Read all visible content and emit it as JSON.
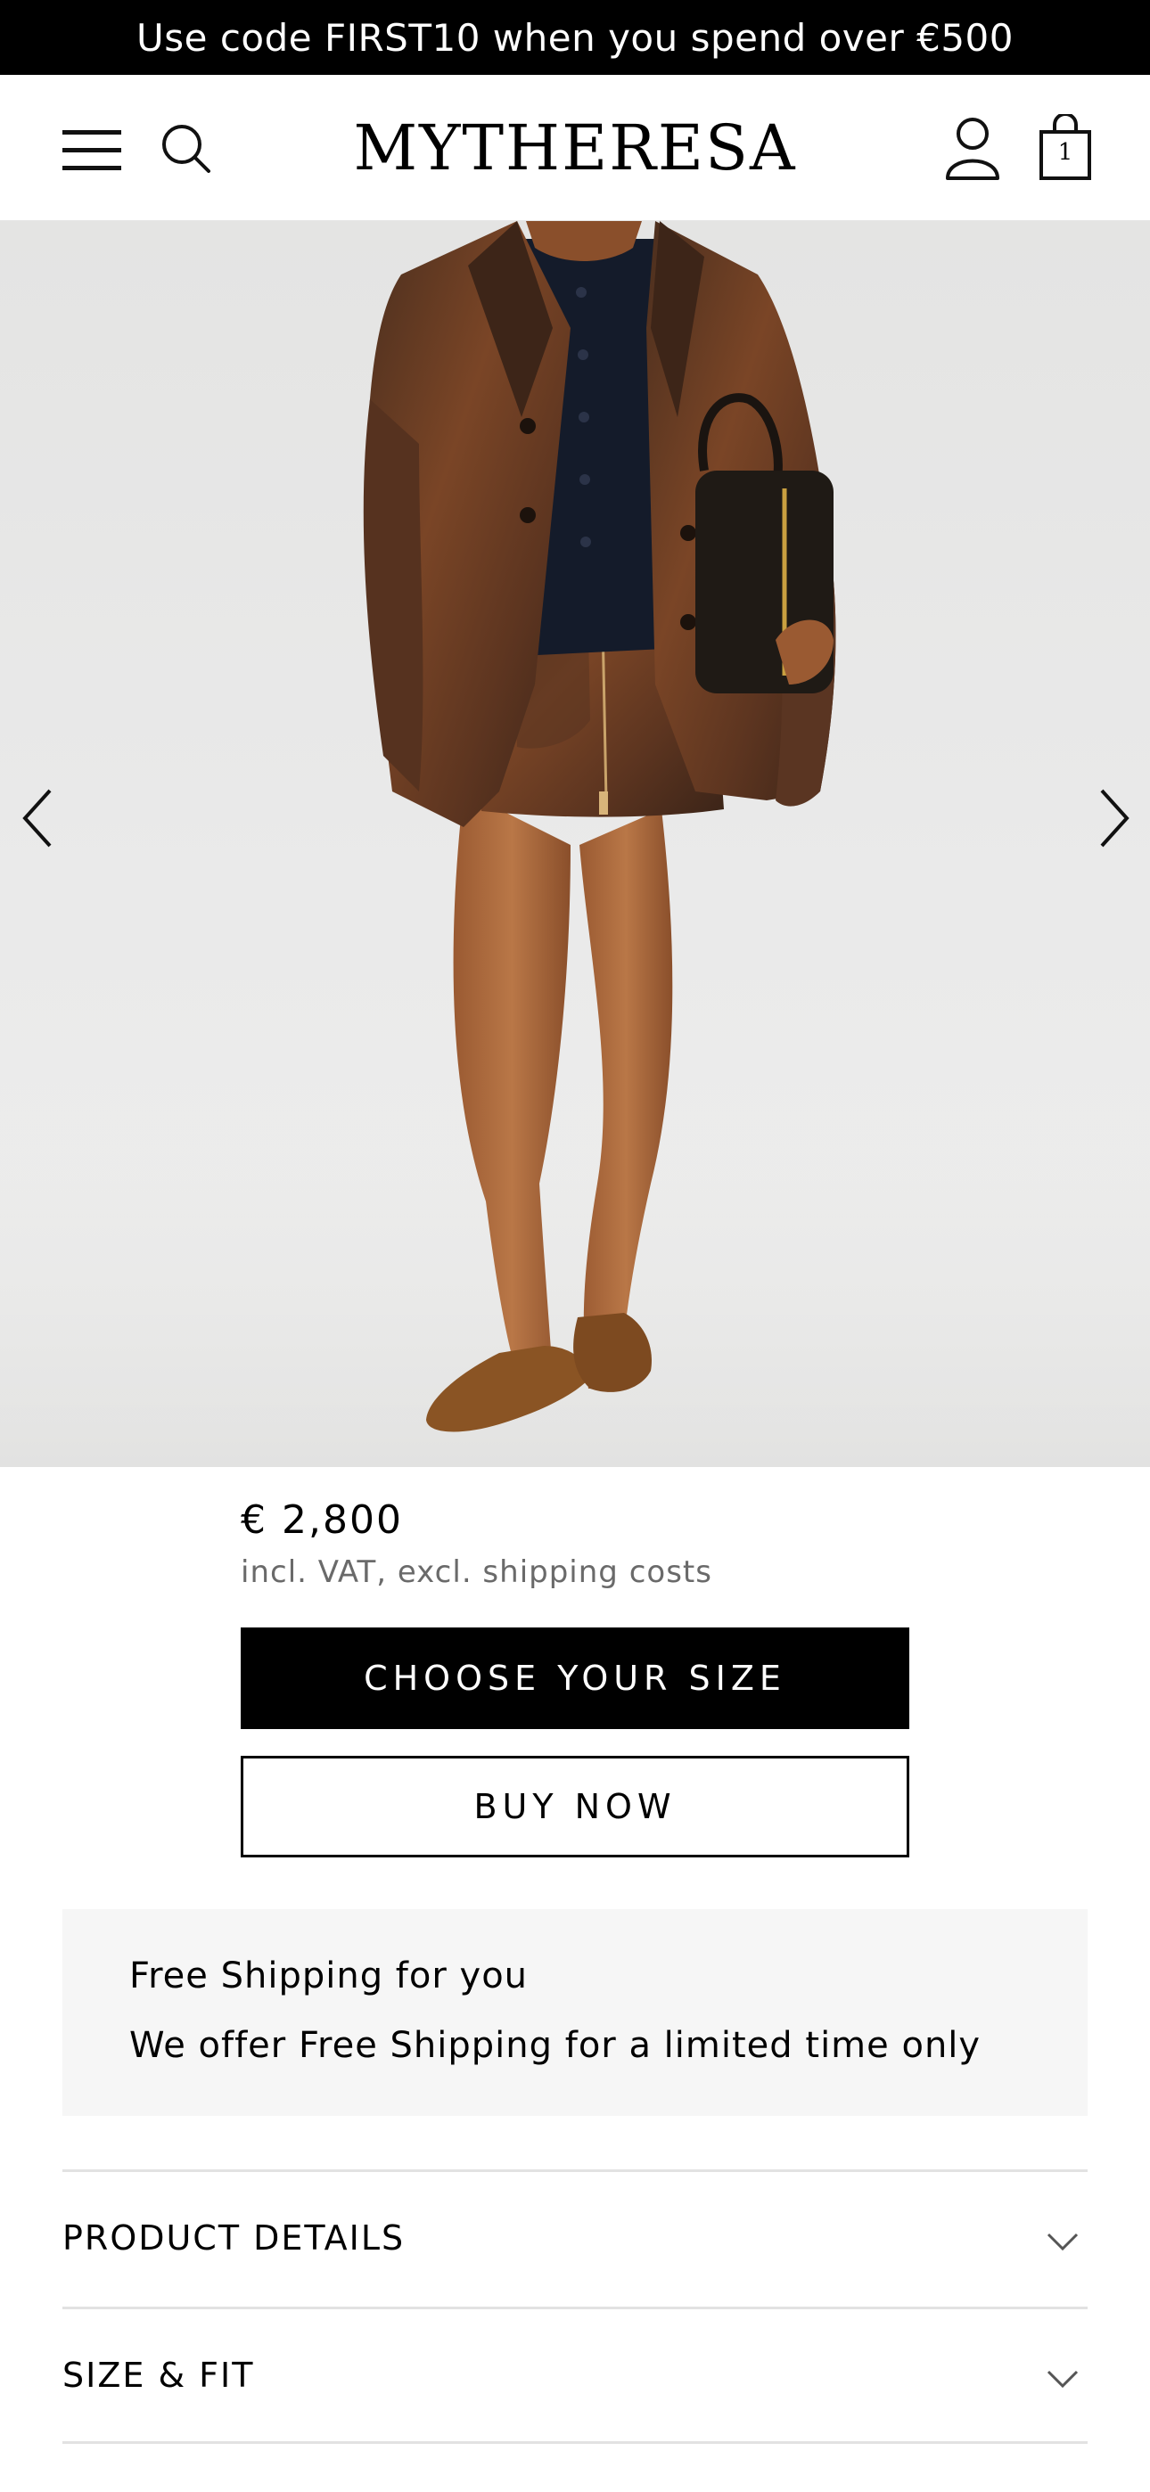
{
  "promo": {
    "text": "Use code FIRST10 when you spend over €500"
  },
  "header": {
    "logo": "MYTHERESA",
    "menu_icon": "hamburger-menu-icon",
    "search_icon": "search-icon",
    "account_icon": "account-icon",
    "bag_icon": "shopping-bag-icon",
    "bag_count": "1"
  },
  "gallery": {
    "prev_icon": "chevron-left-icon",
    "next_icon": "chevron-right-icon",
    "image_alt": "Model wearing brown distressed leather jacket and mini skirt with black bag and suede loafers"
  },
  "product": {
    "price": "€ 2,800",
    "tax_note": "incl. VAT, excl. shipping costs",
    "choose_size_label": "CHOOSE YOUR SIZE",
    "buy_now_label": "BUY NOW"
  },
  "shipping": {
    "title": "Free Shipping for you",
    "text": "We offer Free Shipping for a limited time only"
  },
  "accordion": [
    {
      "label": "PRODUCT DETAILS"
    },
    {
      "label": "SIZE & FIT"
    }
  ],
  "colors": {
    "promo_bg": "#000000",
    "primary_button": "#000000",
    "shipping_bg": "#f6f6f6",
    "secondary_text": "#6a6a6a",
    "leather_brown": "#6b3f22",
    "suede": "#8a5424"
  }
}
